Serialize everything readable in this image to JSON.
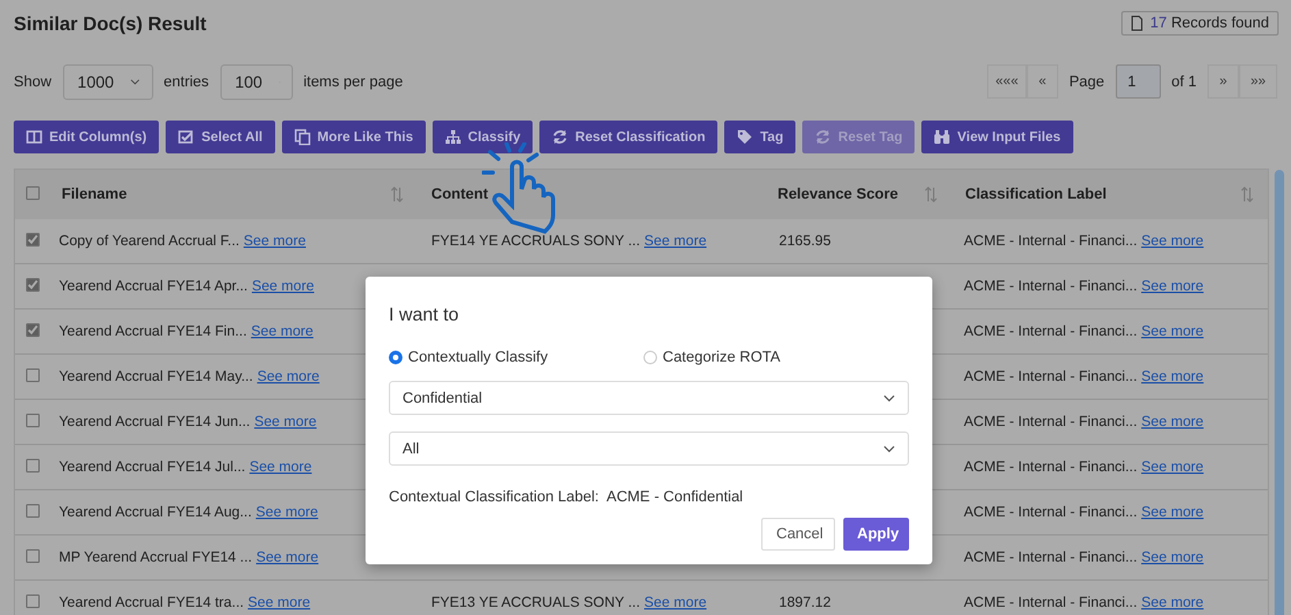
{
  "header": {
    "title": "Similar Doc(s) Result",
    "records_count": "17",
    "records_label": "Records found"
  },
  "controls": {
    "show_label": "Show",
    "entries_value": "1000",
    "entries_label": "entries",
    "per_page_value": "100",
    "per_page_label": "items per page",
    "pager": {
      "first": "«««",
      "prev": "«",
      "page_label": "Page",
      "page_value": "1",
      "of_label": "of 1",
      "next": "»",
      "last": "»»"
    }
  },
  "toolbar": [
    {
      "label": "Edit Column(s)",
      "disabled": false
    },
    {
      "label": "Select All",
      "disabled": false
    },
    {
      "label": "More Like This",
      "disabled": false
    },
    {
      "label": "Classify",
      "disabled": false
    },
    {
      "label": "Reset Classification",
      "disabled": false
    },
    {
      "label": "Tag",
      "disabled": false
    },
    {
      "label": "Reset Tag",
      "disabled": true
    },
    {
      "label": "View Input Files",
      "disabled": false
    }
  ],
  "table": {
    "select_all_checked": false,
    "columns": [
      {
        "label": "Filename",
        "sortable": true
      },
      {
        "label": "Content",
        "sortable": false
      },
      {
        "label": "Relevance Score",
        "sortable": true
      },
      {
        "label": "Classification Label",
        "sortable": true
      }
    ],
    "rows": [
      {
        "checked": true,
        "filename": "Copy of Yearend Accrual F...",
        "filename_link": "See more",
        "content": "FYE14 YE ACCRUALS SONY ...",
        "content_link": "See more",
        "score": "2165.95",
        "label": "ACME - Internal - Financi...",
        "label_link": "See more"
      },
      {
        "checked": true,
        "filename": "Yearend Accrual FYE14 Apr...",
        "filename_link": "See more",
        "label": "ACME - Internal - Financi...",
        "label_link": "See more"
      },
      {
        "checked": true,
        "filename": "Yearend Accrual FYE14 Fin...",
        "filename_link": "See more",
        "label": "ACME - Internal - Financi...",
        "label_link": "See more"
      },
      {
        "checked": false,
        "filename": "Yearend Accrual FYE14 May...",
        "filename_link": "See more",
        "label": "ACME - Internal - Financi...",
        "label_link": "See more"
      },
      {
        "checked": false,
        "filename": "Yearend Accrual FYE14 Jun...",
        "filename_link": "See more",
        "label": "ACME - Internal - Financi...",
        "label_link": "See more"
      },
      {
        "checked": false,
        "filename": "Yearend Accrual FYE14 Jul...",
        "filename_link": "See more",
        "label": "ACME - Internal - Financi...",
        "label_link": "See more"
      },
      {
        "checked": false,
        "filename": "Yearend Accrual FYE14 Aug...",
        "filename_link": "See more",
        "label": "ACME - Internal - Financi...",
        "label_link": "See more"
      },
      {
        "checked": false,
        "filename": "MP Yearend Accrual FYE14 ...",
        "filename_link": "See more",
        "label": "ACME - Internal - Financi...",
        "label_link": "See more"
      },
      {
        "checked": false,
        "filename": "Yearend Accrual FYE14 tra...",
        "filename_link": "See more",
        "content": "FYE13 YE ACCRUALS SONY ...",
        "content_link": "See more",
        "score": "1897.12",
        "label": "ACME - Internal - Financi...",
        "label_link": "See more"
      }
    ]
  },
  "dialog": {
    "title": "I want to",
    "options": [
      {
        "label": "Contextually Classify",
        "selected": true
      },
      {
        "label": "Categorize ROTA",
        "selected": false
      }
    ],
    "level_select": "Confidential",
    "scope_select": "All",
    "result_label": "Contextual Classification Label:",
    "result_value": "ACME - Confidential",
    "buttons": [
      {
        "label": "Cancel",
        "kind": "secondary"
      },
      {
        "label": "Apply",
        "kind": "primary"
      }
    ]
  }
}
